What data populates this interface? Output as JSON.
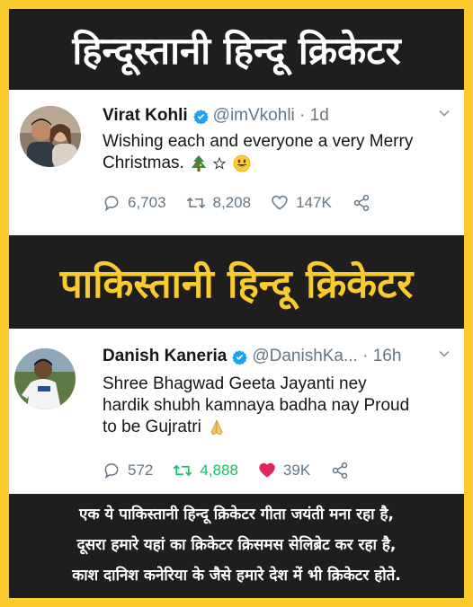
{
  "headings": {
    "top": "हिन्दूस्तानी हिन्दू क्रिकेटर",
    "middle": "पाकिस्तानी हिन्दू क्रिकेटर"
  },
  "tweet1": {
    "name": "Virat Kohli",
    "handle": "@imVkohli · 1d",
    "text_line1": "Wishing each and everyone a very Merry",
    "text_line2": "Christmas.",
    "replies": "6,703",
    "retweets": "8,208",
    "likes": "147K"
  },
  "tweet2": {
    "name": "Danish Kaneria",
    "handle": "@DanishKa... · 16h",
    "text_line1": "Shree  Bhagwad Geeta Jayanti ney",
    "text_line2": "hardik shubh kamnaya badha nay Proud",
    "text_line3": "to be Gujratri",
    "replies": "572",
    "retweets": "4,888",
    "likes": "39K"
  },
  "caption": {
    "line1": "एक ये पाकिस्तानी हिन्दू क्रिकेटर गीता जयंती मना रहा है,",
    "line2": "दूसरा हमारे यहां का क्रिकेटर क्रिसमस सेलिब्रेट कर रहा है,",
    "line3": "काश दानिश कनेरिया के जैसे हमारे देश में भी क्रिकेटर होते."
  },
  "colors": {
    "background": "#fbcb2d",
    "bar": "#1e1e1e",
    "verified": "#1da1f2",
    "retweet_active": "#17bf63",
    "like_active": "#e0245e"
  },
  "icons": [
    "verified-badge-icon",
    "chevron-down-icon",
    "reply-icon",
    "retweet-icon",
    "like-icon",
    "share-icon",
    "christmas-tree-emoji",
    "star-emoji",
    "smile-emoji",
    "praying-hands-emoji"
  ]
}
